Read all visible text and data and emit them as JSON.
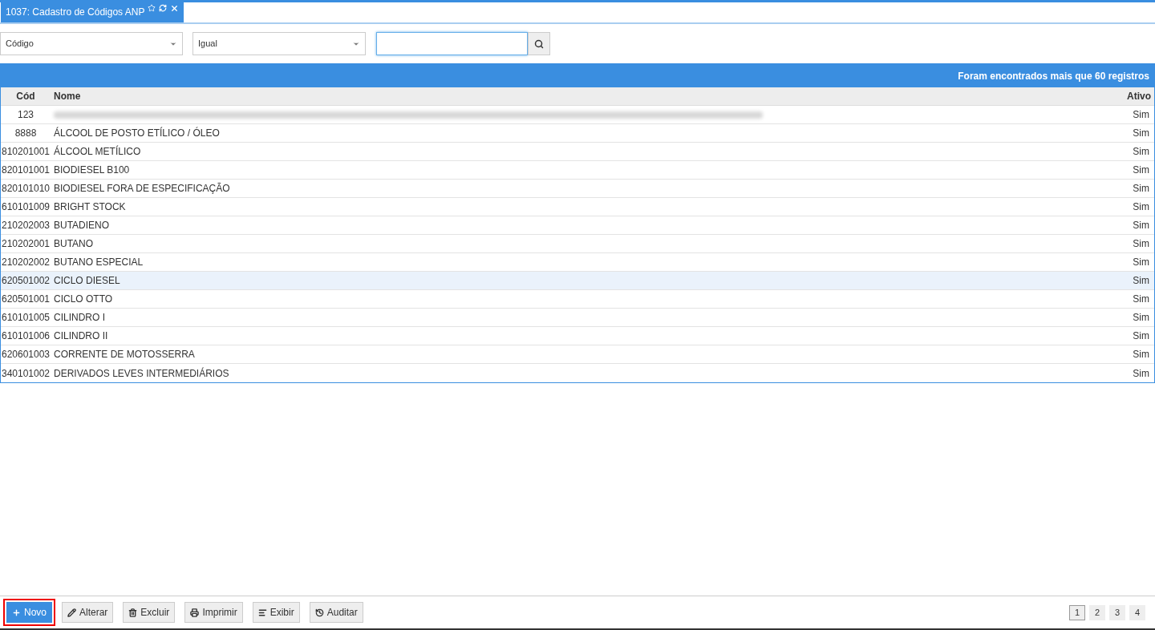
{
  "tab": {
    "title": "1037: Cadastro de Códigos ANP",
    "selected": true
  },
  "filters": {
    "field": "Código",
    "operator": "Igual",
    "search": {
      "focused": true
    }
  },
  "table": {
    "banner": "Foram encontrados mais que 60 registros",
    "columns": [
      "Cód",
      "Nome",
      "Ativo"
    ],
    "rows": [
      {
        "cod": "123",
        "redacted": true,
        "ativo": "Sim",
        "selected": false
      },
      {
        "cod": "8888",
        "nome": "ÁLCOOL DE POSTO ETÍLICO / ÓLEO",
        "ativo": "Sim",
        "selected": false
      },
      {
        "cod": "810201001",
        "nome": "ÁLCOOL METÍLICO",
        "ativo": "Sim",
        "selected": false
      },
      {
        "cod": "820101001",
        "nome": "BIODIESEL B100",
        "ativo": "Sim",
        "selected": false
      },
      {
        "cod": "820101010",
        "nome": "BIODIESEL FORA DE ESPECIFICAÇÃO",
        "ativo": "Sim",
        "selected": false
      },
      {
        "cod": "610101009",
        "nome": "BRIGHT STOCK",
        "ativo": "Sim",
        "selected": false
      },
      {
        "cod": "210202003",
        "nome": "BUTADIENO",
        "ativo": "Sim",
        "selected": false
      },
      {
        "cod": "210202001",
        "nome": "BUTANO",
        "ativo": "Sim",
        "selected": false
      },
      {
        "cod": "210202002",
        "nome": "BUTANO ESPECIAL",
        "ativo": "Sim",
        "selected": false
      },
      {
        "cod": "620501002",
        "nome": "CICLO DIESEL",
        "ativo": "Sim",
        "selected": true
      },
      {
        "cod": "620501001",
        "nome": "CICLO OTTO",
        "ativo": "Sim",
        "selected": false
      },
      {
        "cod": "610101005",
        "nome": "CILINDRO I",
        "ativo": "Sim",
        "selected": false
      },
      {
        "cod": "610101006",
        "nome": "CILINDRO II",
        "ativo": "Sim",
        "selected": false
      },
      {
        "cod": "620601003",
        "nome": "CORRENTE DE MOTOSSERRA",
        "ativo": "Sim",
        "selected": false
      },
      {
        "cod": "340101002",
        "nome": "DERIVADOS LEVES INTERMEDIÁRIOS",
        "ativo": "Sim",
        "selected": false
      }
    ]
  },
  "actions": [
    {
      "kind": "new",
      "label": "Novo",
      "primary": true,
      "highlighted": true
    },
    {
      "kind": "edit",
      "label": "Alterar",
      "primary": false,
      "highlighted": false
    },
    {
      "kind": "delete",
      "label": "Excluir",
      "primary": false,
      "highlighted": false
    },
    {
      "kind": "print",
      "label": "Imprimir",
      "primary": false,
      "highlighted": false
    },
    {
      "kind": "view",
      "label": "Exibir",
      "primary": false,
      "highlighted": false
    },
    {
      "kind": "audit",
      "label": "Auditar",
      "primary": false,
      "highlighted": false
    }
  ],
  "pages": [
    {
      "label": "1",
      "selected": true
    },
    {
      "label": "2",
      "selected": false
    },
    {
      "label": "3",
      "selected": false
    },
    {
      "label": "4",
      "selected": false
    }
  ]
}
